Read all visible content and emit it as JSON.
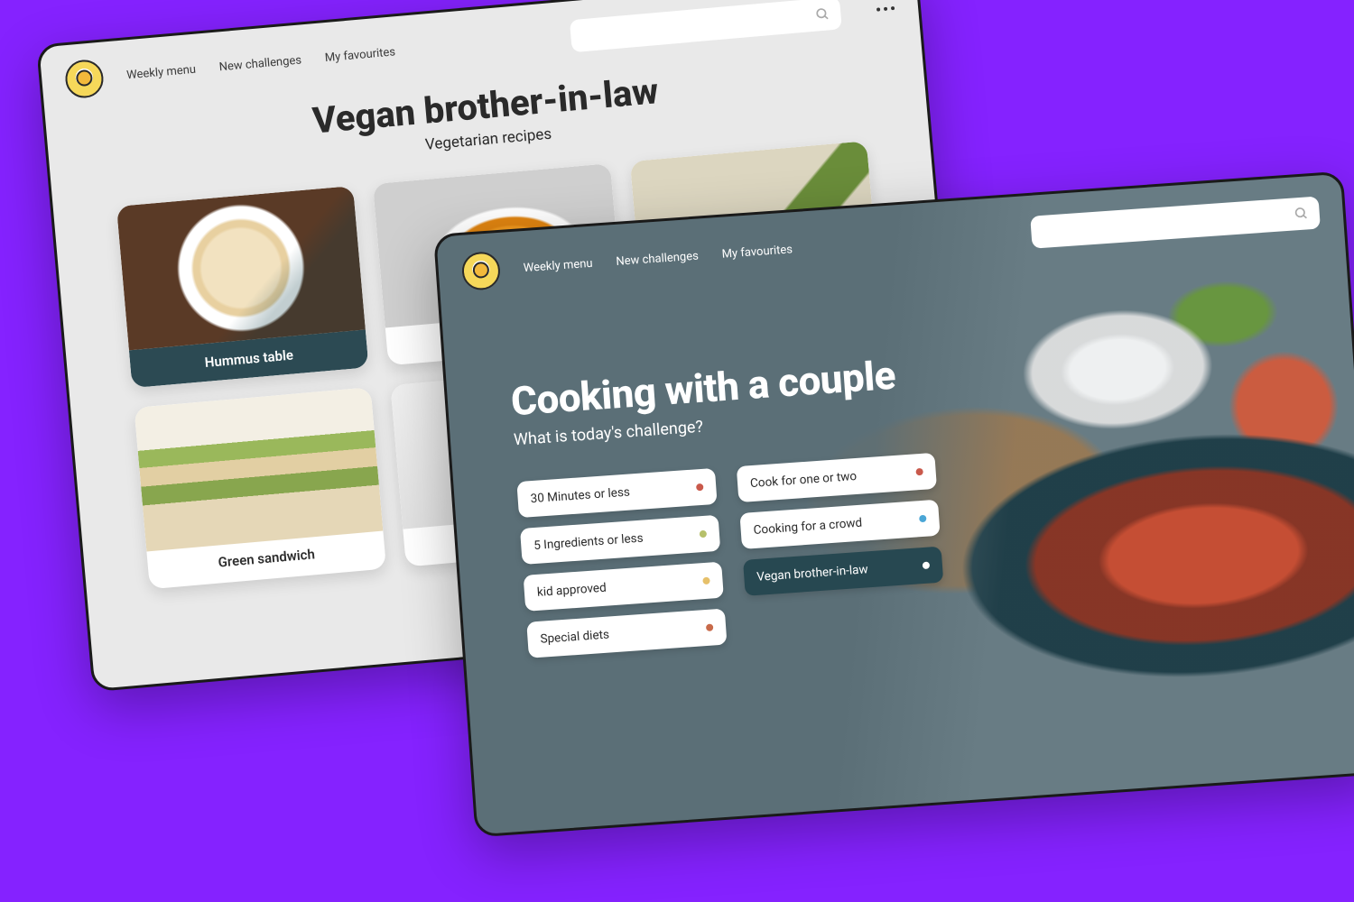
{
  "nav": {
    "items": [
      "Weekly menu",
      "New challenges",
      "My favourites"
    ],
    "search_placeholder": ""
  },
  "back_panel": {
    "title": "Vegan brother-in-law",
    "subtitle": "Vegetarian recipes",
    "recipes": [
      {
        "label": "Hummus table",
        "image": "hummus",
        "selected": true
      },
      {
        "label": "",
        "image": "soup",
        "selected": false
      },
      {
        "label": "",
        "image": "avocado",
        "selected": false
      },
      {
        "label": "Green sandwich",
        "image": "sandwich",
        "selected": false
      },
      {
        "label": "",
        "image": "gen1",
        "selected": false
      }
    ]
  },
  "front_panel": {
    "title": "Cooking with a couple",
    "subtitle": "What is today's challenge?",
    "chip_columns": [
      [
        {
          "label": "30 Minutes or less",
          "dot": "#c9594b",
          "active": false
        },
        {
          "label": "5 Ingredients or less",
          "dot": "#b6c06a",
          "active": false
        },
        {
          "label": "kid approved",
          "dot": "#e6c06a",
          "active": false
        },
        {
          "label": "Special diets",
          "dot": "#c86a4a",
          "active": false
        }
      ],
      [
        {
          "label": "Cook for one or two",
          "dot": "#c9594b",
          "active": false
        },
        {
          "label": "Cooking for a crowd",
          "dot": "#4aa6d6",
          "active": false
        },
        {
          "label": "Vegan brother-in-law",
          "dot": "#ffffff",
          "active": true
        }
      ]
    ]
  },
  "colors": {
    "bg": "#8522ff",
    "chip_active_bg": "#274851"
  }
}
